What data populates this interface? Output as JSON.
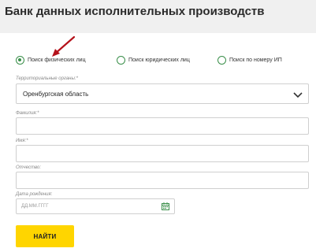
{
  "page": {
    "title": "Банк данных исполнительных производств"
  },
  "search_type": {
    "options": [
      {
        "label": "Поиск физических лиц",
        "selected": true
      },
      {
        "label": "Поиск юридических лиц",
        "selected": false
      },
      {
        "label": "Поиск по номеру ИП",
        "selected": false
      }
    ]
  },
  "fields": {
    "territorial_label": "Территориальные органы:*",
    "territorial_value": "Оренбургская область",
    "lastname_label": "Фамилия:*",
    "firstname_label": "Имя:*",
    "patronymic_label": "Отчество:",
    "birthdate_label": "Дата рождения:",
    "birthdate_placeholder": "ДД.ММ.ГГГГ"
  },
  "actions": {
    "submit_label": "НАЙТИ"
  },
  "colors": {
    "accent_green": "#3a8f4a",
    "button_yellow": "#ffd500",
    "arrow_red": "#b5121b"
  },
  "icons": {
    "select": "chevron-down-icon",
    "date": "calendar-icon",
    "annotation": "red-arrow-icon"
  }
}
